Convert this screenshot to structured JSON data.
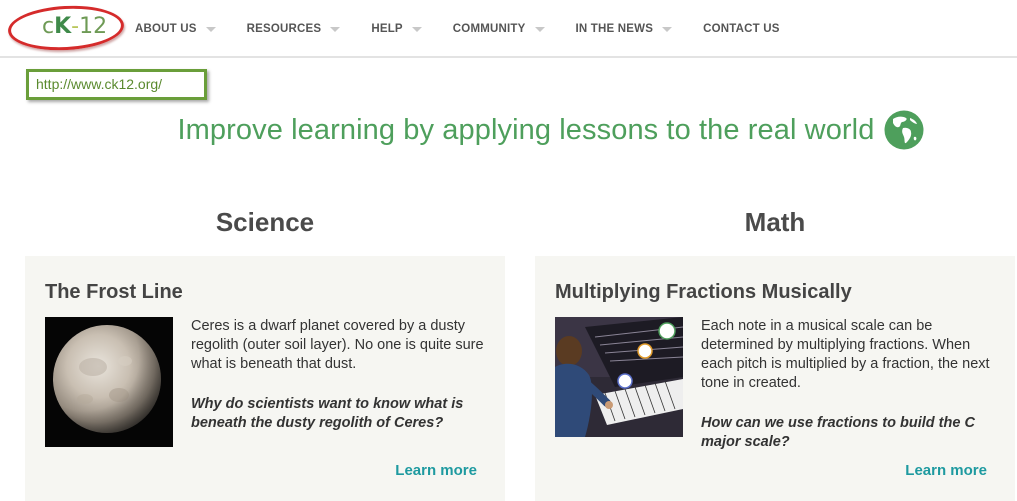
{
  "logo": {
    "c": "c",
    "k": "K",
    "dash": "-",
    "num": "12"
  },
  "nav": {
    "items": [
      {
        "label": "ABOUT US",
        "has_caret": true
      },
      {
        "label": "RESOURCES",
        "has_caret": true
      },
      {
        "label": "HELP",
        "has_caret": true
      },
      {
        "label": "COMMUNITY",
        "has_caret": true
      },
      {
        "label": "IN THE NEWS",
        "has_caret": true
      },
      {
        "label": "CONTACT US",
        "has_caret": false
      }
    ]
  },
  "url_annotation": "http://www.ck12.org/",
  "headline": "Improve learning by applying lessons to the real world",
  "columns": [
    {
      "subject": "Science",
      "card": {
        "title": "The Frost Line",
        "body": "Ceres is a dwarf planet covered by a dusty regolith (outer soil layer). No one is quite sure what is beneath that dust.",
        "question": "Why do scientists want to know what is beneath the dusty regolith of Ceres?",
        "link": "Learn more"
      }
    },
    {
      "subject": "Math",
      "card": {
        "title": "Multiplying Fractions Musically",
        "body": "Each note in a musical scale can be determined by multiplying fractions. When each pitch is multiplied by a fraction, the next tone in created.",
        "question": "How can we use fractions to build the C major scale?",
        "link": "Learn more"
      }
    }
  ],
  "colors": {
    "brand_green": "#4e9f5c",
    "link_teal": "#1e9aa0",
    "annotation_red": "#d52b2b",
    "annotation_green": "#6a9e3a",
    "card_bg": "#f6f6f2"
  }
}
